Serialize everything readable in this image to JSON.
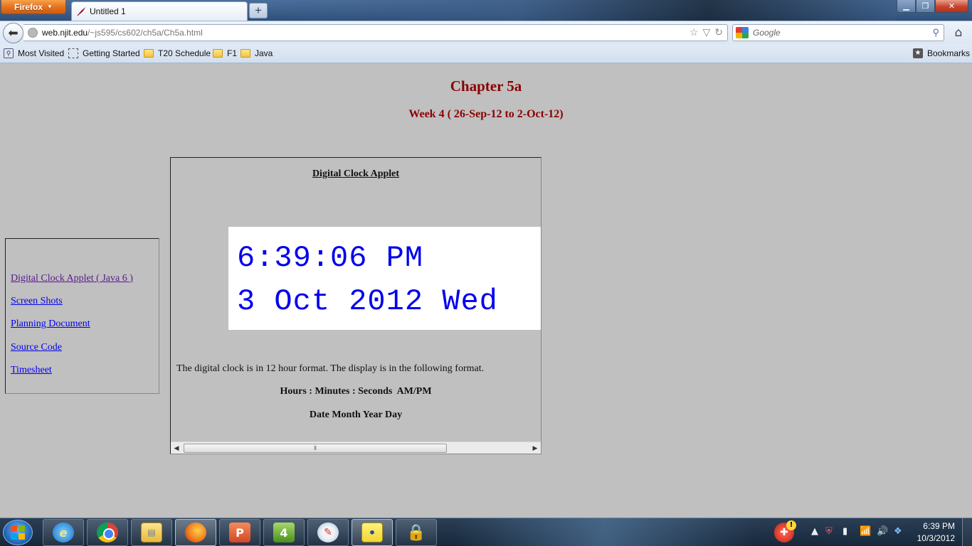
{
  "browser": {
    "menu_button": "Firefox",
    "tab_title": "Untitled 1",
    "newtab_symbol": "+",
    "url_domain": "web.njit.edu",
    "url_path": "/~js595/cs602/ch5a/Ch5a.html",
    "search_placeholder": "Google",
    "bookmarks": [
      "Most Visited",
      "Getting Started",
      "T20 Schedule",
      "F1",
      "Java"
    ],
    "bookmarks_menu": "Bookmarks"
  },
  "page": {
    "chapter_title": "Chapter 5a",
    "week_title": "Week 4 ( 26-Sep-12 to 2-Oct-12)",
    "nav_links": [
      {
        "label": "Digital Clock Applet ( Java 6 )",
        "visited": true
      },
      {
        "label": "Screen Shots",
        "visited": false
      },
      {
        "label": "Planning Document",
        "visited": false
      },
      {
        "label": "Source Code",
        "visited": false
      },
      {
        "label": "Timesheet",
        "visited": false
      }
    ],
    "applet_title": "Digital Clock Applet",
    "clock_time": "6:39:06 PM",
    "clock_date": "3 Oct 2012 Wed",
    "clock_color": "#0000ee",
    "description": "The digital clock is in 12 hour format. The display is in the following format.",
    "format_line1": "Hours : Minutes : Seconds  AM/PM",
    "format_line2": "Date Month Year Day",
    "heading_color": "#8b0000"
  },
  "taskbar": {
    "apps": [
      "internet-explorer",
      "chrome",
      "windows-explorer",
      "firefox",
      "powerpoint",
      "green-app",
      "paint",
      "sticky-notes",
      "lock-app"
    ],
    "active_app": "firefox",
    "tray_time": "6:39 PM",
    "tray_date": "10/3/2012"
  }
}
